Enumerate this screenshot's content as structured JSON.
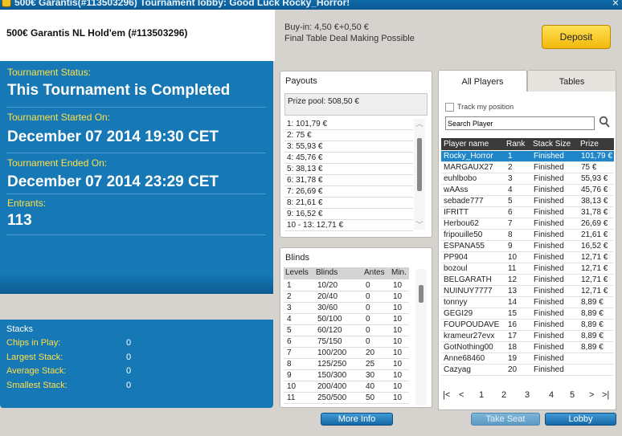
{
  "window": {
    "title": "500€ Garantis(#113503296) Tournament lobby: Good Luck Rocky_Horror!",
    "close_glyph": "×"
  },
  "header": {
    "tournament_name": "500€ Garantis NL Hold'em (#113503296)",
    "buyin": "Buy-in: 4,50 €+0,50 €",
    "deal_making": "Final Table Deal Making Possible",
    "deposit_label": "Deposit"
  },
  "status": {
    "status_label": "Tournament Status:",
    "status_value": "This Tournament is Completed",
    "started_label": "Tournament Started On:",
    "started_value": "December 07 2014  19:30 CET",
    "ended_label": "Tournament Ended On:",
    "ended_value": "December 07 2014  23:29 CET",
    "entrants_label": "Entrants:",
    "entrants_value": "113"
  },
  "stacks": {
    "title": "Stacks",
    "rows": [
      {
        "label": "Chips in Play:",
        "value": "0"
      },
      {
        "label": "Largest Stack:",
        "value": "0"
      },
      {
        "label": "Average Stack:",
        "value": "0"
      },
      {
        "label": "Smallest Stack:",
        "value": "0"
      }
    ]
  },
  "payouts": {
    "title": "Payouts",
    "prize_pool": "Prize pool: 508,50 €",
    "rows": [
      "1: 101,79 €",
      "2: 75 €",
      "3: 55,93 €",
      "4: 45,76 €",
      "5: 38,13 €",
      "6: 31,78 €",
      "7: 26,69 €",
      "8: 21,61 €",
      "9: 16,52 €",
      "10 - 13: 12,71 €"
    ]
  },
  "blinds": {
    "title": "Blinds",
    "headers": {
      "levels": "Levels",
      "blinds": "Blinds",
      "antes": "Antes",
      "min": "Min."
    },
    "rows": [
      {
        "level": "1",
        "blinds": "10/20",
        "antes": "0",
        "min": "10"
      },
      {
        "level": "2",
        "blinds": "20/40",
        "antes": "0",
        "min": "10"
      },
      {
        "level": "3",
        "blinds": "30/60",
        "antes": "0",
        "min": "10"
      },
      {
        "level": "4",
        "blinds": "50/100",
        "antes": "0",
        "min": "10"
      },
      {
        "level": "5",
        "blinds": "60/120",
        "antes": "0",
        "min": "10"
      },
      {
        "level": "6",
        "blinds": "75/150",
        "antes": "0",
        "min": "10"
      },
      {
        "level": "7",
        "blinds": "100/200",
        "antes": "20",
        "min": "10"
      },
      {
        "level": "8",
        "blinds": "125/250",
        "antes": "25",
        "min": "10"
      },
      {
        "level": "9",
        "blinds": "150/300",
        "antes": "30",
        "min": "10"
      },
      {
        "level": "10",
        "blinds": "200/400",
        "antes": "40",
        "min": "10"
      },
      {
        "level": "11",
        "blinds": "250/500",
        "antes": "50",
        "min": "10"
      }
    ]
  },
  "players": {
    "tabs": [
      "All Players",
      "Tables"
    ],
    "track_label": "Track my position",
    "search_value": "Search Player",
    "headers": {
      "name": "Player name",
      "rank": "Rank",
      "stack": "Stack Size",
      "prize": "Prize"
    },
    "rows": [
      {
        "name": "Rocky_Horror",
        "rank": "1",
        "stack": "Finished",
        "prize": "101,79 €"
      },
      {
        "name": "MARGAUX27",
        "rank": "2",
        "stack": "Finished",
        "prize": "75 €"
      },
      {
        "name": "euhlbobo",
        "rank": "3",
        "stack": "Finished",
        "prize": "55,93 €"
      },
      {
        "name": "wAAss",
        "rank": "4",
        "stack": "Finished",
        "prize": "45,76 €"
      },
      {
        "name": "sebade777",
        "rank": "5",
        "stack": "Finished",
        "prize": "38,13 €"
      },
      {
        "name": "IFRITT",
        "rank": "6",
        "stack": "Finished",
        "prize": "31,78 €"
      },
      {
        "name": "Herbou62",
        "rank": "7",
        "stack": "Finished",
        "prize": "26,69 €"
      },
      {
        "name": "fripouille50",
        "rank": "8",
        "stack": "Finished",
        "prize": "21,61 €"
      },
      {
        "name": "ESPANA55",
        "rank": "9",
        "stack": "Finished",
        "prize": "16,52 €"
      },
      {
        "name": "PP904",
        "rank": "10",
        "stack": "Finished",
        "prize": "12,71 €"
      },
      {
        "name": "bozoul",
        "rank": "11",
        "stack": "Finished",
        "prize": "12,71 €"
      },
      {
        "name": "BELGARATH",
        "rank": "12",
        "stack": "Finished",
        "prize": "12,71 €"
      },
      {
        "name": "NUINUY7777",
        "rank": "13",
        "stack": "Finished",
        "prize": "12,71 €"
      },
      {
        "name": "tonnyy",
        "rank": "14",
        "stack": "Finished",
        "prize": "8,89 €"
      },
      {
        "name": "GEGI29",
        "rank": "15",
        "stack": "Finished",
        "prize": "8,89 €"
      },
      {
        "name": "FOUPOUDAVE",
        "rank": "16",
        "stack": "Finished",
        "prize": "8,89 €"
      },
      {
        "name": "krameur27evx",
        "rank": "17",
        "stack": "Finished",
        "prize": "8,89 €"
      },
      {
        "name": "GotNothing00",
        "rank": "18",
        "stack": "Finished",
        "prize": "8,89 €"
      },
      {
        "name": "Anne68460",
        "rank": "19",
        "stack": "Finished",
        "prize": ""
      },
      {
        "name": "Cazyag",
        "rank": "20",
        "stack": "Finished",
        "prize": ""
      }
    ],
    "pager": {
      "first": "|<",
      "prev": "<",
      "pages": [
        "1",
        "2",
        "3",
        "4",
        "5"
      ],
      "next": ">",
      "last": ">|"
    }
  },
  "buttons": {
    "more_info": "More Info",
    "take_seat": "Take Seat",
    "lobby": "Lobby"
  }
}
